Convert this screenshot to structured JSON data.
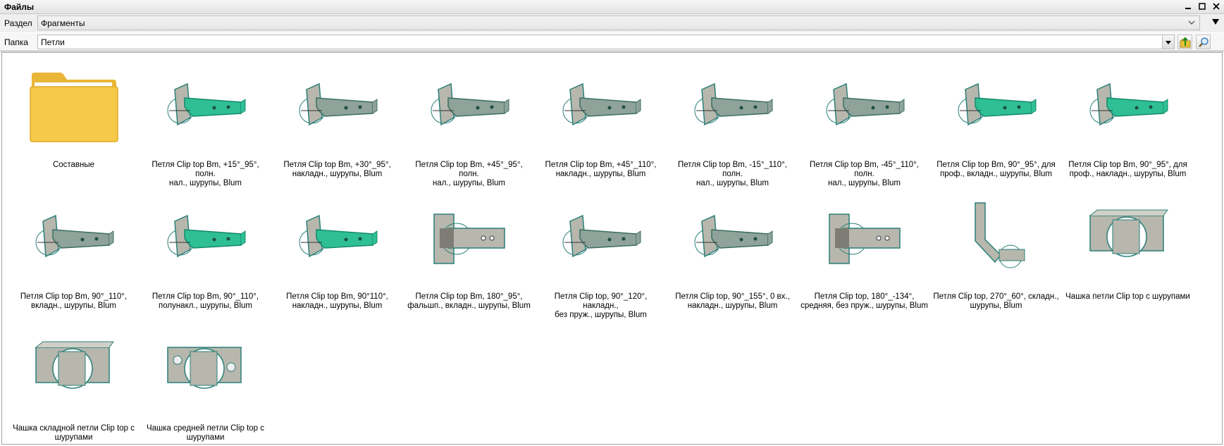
{
  "window": {
    "title": "Файлы"
  },
  "section": {
    "label": "Раздел",
    "value": "Фрагменты"
  },
  "folder": {
    "label": "Папка",
    "value": "Петли"
  },
  "items": [
    {
      "label": "Составные",
      "kind": "folder",
      "icon": "folder-icon"
    },
    {
      "label": "Петля Clip top Вm, +15°_95°, полн.\nнал., шурупы, Blum",
      "kind": "hinge-green",
      "icon": "hinge-icon"
    },
    {
      "label": "Петля Clip top Вm, +30°_95°,\nнакладн., шурупы, Blum",
      "kind": "hinge-gray",
      "icon": "hinge-icon"
    },
    {
      "label": "Петля Clip top Вm, +45°_95°, полн.\nнал., шурупы, Blum",
      "kind": "hinge-gray",
      "icon": "hinge-icon"
    },
    {
      "label": "Петля Clip top Вm, +45°_110°,\nнакладн., шурупы, Blum",
      "kind": "hinge-gray",
      "icon": "hinge-icon"
    },
    {
      "label": "Петля Clip top Вm, -15°_110°, полн.\nнал., шурупы, Blum",
      "kind": "hinge-gray",
      "icon": "hinge-icon"
    },
    {
      "label": "Петля Clip top Вm, -45°_110°, полн.\nнал., шурупы, Blum",
      "kind": "hinge-gray",
      "icon": "hinge-icon"
    },
    {
      "label": "Петля Clip top Вm, 90°_95°, для\nпроф., вкладн., шурупы, Blum",
      "kind": "hinge-green",
      "icon": "hinge-icon"
    },
    {
      "label": "Петля Clip top Вm, 90°_95°, для\nпроф., накладн., шурупы, Blum",
      "kind": "hinge-green",
      "icon": "hinge-icon"
    },
    {
      "label": "Петля Clip top Вm, 90°_110°,\nвкладн., шурупы, Blum",
      "kind": "hinge-gray",
      "icon": "hinge-icon"
    },
    {
      "label": "Петля Clip top Вm, 90°_110°,\nполунакл., шурупы, Blum",
      "kind": "hinge-green",
      "icon": "hinge-icon"
    },
    {
      "label": "Петля Clip top Вm, 90°110°,\nнакладн., шурупы, Blum",
      "kind": "hinge-green",
      "icon": "hinge-icon"
    },
    {
      "label": "Петля Clip top Вm, 180°_95°,\nфальшп., вкладн., шурупы, Blum",
      "kind": "hinge-flat",
      "icon": "hinge-icon"
    },
    {
      "label": "Петля Clip top, 90°_120°, накладн.,\nбез пруж., шурупы, Blum",
      "kind": "hinge-gray",
      "icon": "hinge-icon"
    },
    {
      "label": "Петля Clip top, 90°_155°, 0 вх.,\nнакладн., шурупы, Blum",
      "kind": "hinge-gray",
      "icon": "hinge-icon"
    },
    {
      "label": "Петля Clip top, 180°_-134°,\nсредняя, без пруж., шурупы, Blum",
      "kind": "hinge-flat",
      "icon": "hinge-icon"
    },
    {
      "label": "Петля Clip top, 270°_60°, складн.,\nшурупы, Blum",
      "kind": "hinge-tall",
      "icon": "hinge-icon"
    },
    {
      "label": "Чашка петли Clip top с шурупами",
      "kind": "cup",
      "icon": "hinge-cup-icon"
    },
    {
      "label": "Чашка складной петли Clip top с\nшурупами",
      "kind": "cup",
      "icon": "hinge-cup-icon"
    },
    {
      "label": "Чашка средней петли Clip top с\nшурупами",
      "kind": "cup-round",
      "icon": "hinge-cup-icon"
    }
  ]
}
